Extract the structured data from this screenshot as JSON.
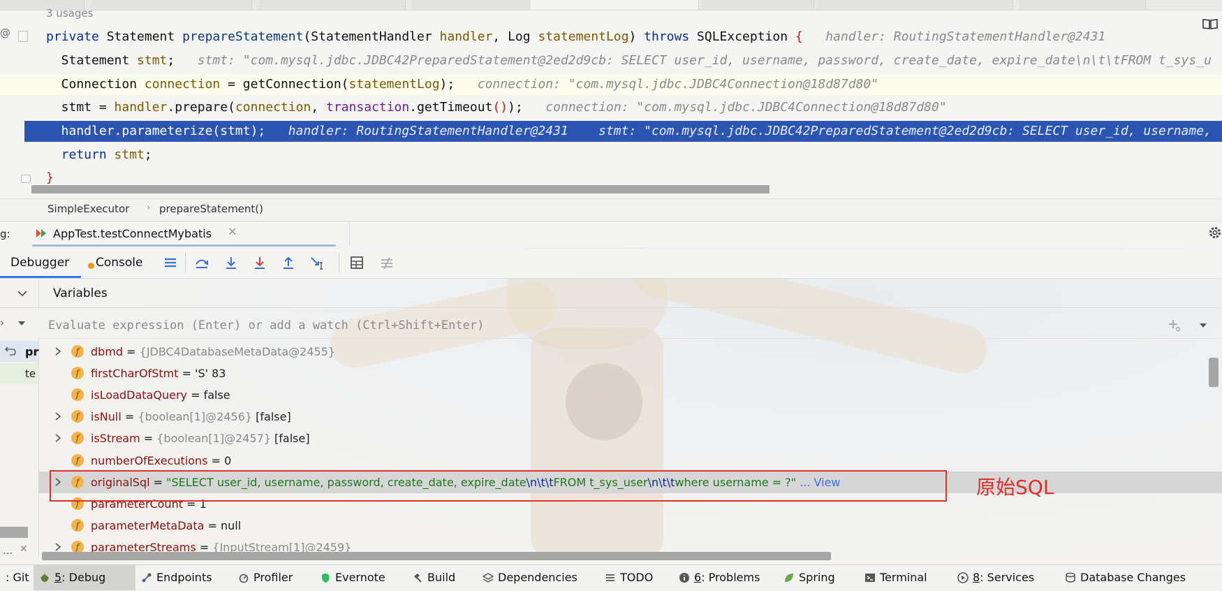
{
  "editor": {
    "usages": "3 usages",
    "gutter_marker": "@",
    "lines": [
      {
        "segments": [
          [
            "kw",
            "private "
          ],
          [
            "ty",
            "Statement "
          ],
          [
            "fn",
            "prepareStatement"
          ],
          [
            "ty",
            "(StatementHandler "
          ],
          [
            "pv",
            "handler"
          ],
          [
            "ty",
            ", Log "
          ],
          [
            "pv",
            "statementLog"
          ],
          [
            "ty",
            ") "
          ],
          [
            "kw",
            "throws "
          ],
          [
            "ty",
            "SQLException "
          ],
          [
            "brace-red",
            "{"
          ],
          [
            "hint",
            "   handler: RoutingStatementHandler@2431"
          ]
        ]
      },
      {
        "segments": [
          [
            "ty",
            "  Statement "
          ],
          [
            "pv",
            "stmt"
          ],
          [
            "ty",
            ";"
          ],
          [
            "hint",
            "   stmt: \"com.mysql.jdbc.JDBC42PreparedStatement@2ed2d9cb: SELECT user_id, username, password, create_date, expire_date\\n\\t\\tFROM t_sys_u"
          ]
        ]
      },
      {
        "segments": [
          [
            "ty",
            "  Connection "
          ],
          [
            "pv",
            "connection"
          ],
          [
            "ty",
            " = getConnection("
          ],
          [
            "pv",
            "statementLog"
          ],
          [
            "ty",
            ");"
          ],
          [
            "hint",
            "   connection: \"com.mysql.jdbc.JDBC4Connection@18d87d80\""
          ]
        ]
      },
      {
        "segments": [
          [
            "ty",
            "  stmt = "
          ],
          [
            "pv",
            "handler"
          ],
          [
            "ty",
            ".prepare("
          ],
          [
            "pv",
            "connection"
          ],
          [
            "ty",
            ", "
          ],
          [
            "pr",
            "transaction"
          ],
          [
            "ty",
            ".getTimeout"
          ],
          [
            "brace-red",
            "()"
          ],
          [
            "ty",
            ");"
          ],
          [
            "hint",
            "   connection: \"com.mysql.jdbc.JDBC4Connection@18d87d80\""
          ]
        ]
      },
      {
        "segments": [
          [
            "plain",
            "  handler.parameterize(stmt);"
          ],
          [
            "hint",
            "   handler: RoutingStatementHandler@2431    stmt: \"com.mysql.jdbc.JDBC42PreparedStatement@2ed2d9cb: SELECT user_id, username,"
          ]
        ]
      },
      {
        "segments": [
          [
            "kw",
            "  return "
          ],
          [
            "pv",
            "stmt"
          ],
          [
            "ty",
            ";"
          ]
        ]
      },
      {
        "segments": [
          [
            "brace-red",
            "}"
          ]
        ]
      }
    ]
  },
  "breadcrumb": {
    "class_name": "SimpleExecutor",
    "separator": "›",
    "method_name": "prepareStatement()"
  },
  "debug_window": {
    "title_prefix": "g:",
    "run_config": "AppTest.testConnectMybatis",
    "close_glyph": "✕",
    "tabs": {
      "debugger": "Debugger",
      "console": "Console"
    },
    "variables_title": "Variables",
    "eval_placeholder": "Evaluate expression (Enter) or add a watch (Ctrl+Shift+Enter)",
    "eval_left_glyph": "›",
    "frames": [
      {
        "label": "pr"
      },
      {
        "label": "te"
      }
    ],
    "frames_footer": "..."
  },
  "variables": [
    {
      "name": "dbmd",
      "eq": " = ",
      "type": "{JDBC4DatabaseMetaData@2455}",
      "value": "",
      "expandable": true
    },
    {
      "name": "firstCharOfStmt",
      "eq": " = ",
      "type": "",
      "value": "'S' 83",
      "expandable": false
    },
    {
      "name": "isLoadDataQuery",
      "eq": " = ",
      "type": "",
      "value": "false",
      "expandable": false
    },
    {
      "name": "isNull",
      "eq": " = ",
      "type": "{boolean[1]@2456}",
      "value": " [false]",
      "expandable": true
    },
    {
      "name": "isStream",
      "eq": " = ",
      "type": "{boolean[1]@2457}",
      "value": " [false]",
      "expandable": true
    },
    {
      "name": "numberOfExecutions",
      "eq": " = ",
      "type": "",
      "value": "0",
      "expandable": false
    },
    {
      "name": "originalSql",
      "eq": " = ",
      "type": "",
      "value": "",
      "expandable": true,
      "selected": true,
      "sql_parts": [
        [
          "vs",
          "\"SELECT user_id, username, password, create_date, expire_date"
        ],
        [
          "vesc",
          "\\n\\t\\t"
        ],
        [
          "vs",
          "FROM t_sys_user"
        ],
        [
          "vesc",
          "\\n\\t\\t"
        ],
        [
          "vs",
          "where username = ?\""
        ]
      ],
      "view_link": " ... View"
    },
    {
      "name": "parameterCount",
      "eq": " = ",
      "type": "",
      "value": "1",
      "expandable": false
    },
    {
      "name": "parameterMetaData",
      "eq": " = ",
      "type": "",
      "value": "null",
      "expandable": false
    },
    {
      "name": "parameterStreams",
      "eq": " = ",
      "type": "{InputStream[1]@2459}",
      "value": "",
      "expandable": true
    }
  ],
  "annotation": {
    "text": "原始SQL",
    "color": "#e0302a"
  },
  "bottom_bar": [
    {
      "id": "git",
      "num": "",
      "label": ": Git",
      "icon": "none"
    },
    {
      "id": "debug",
      "num": "5",
      "label": ": Debug",
      "icon": "bug-icon"
    },
    {
      "id": "endpoints",
      "num": "",
      "label": "Endpoints",
      "icon": "endpoints-icon"
    },
    {
      "id": "profiler",
      "num": "",
      "label": "Profiler",
      "icon": "profiler-icon"
    },
    {
      "id": "evernote",
      "num": "",
      "label": "Evernote",
      "icon": "evernote-icon"
    },
    {
      "id": "build",
      "num": "",
      "label": "Build",
      "icon": "hammer-icon"
    },
    {
      "id": "dependencies",
      "num": "",
      "label": "Dependencies",
      "icon": "layers-icon"
    },
    {
      "id": "todo",
      "num": "",
      "label": "TODO",
      "icon": "list-icon"
    },
    {
      "id": "problems",
      "num": "6",
      "label": ": Problems",
      "icon": "info-icon"
    },
    {
      "id": "spring",
      "num": "",
      "label": "Spring",
      "icon": "spring-icon"
    },
    {
      "id": "terminal",
      "num": "",
      "label": "Terminal",
      "icon": "terminal-icon"
    },
    {
      "id": "services",
      "num": "8",
      "label": ": Services",
      "icon": "play-icon"
    },
    {
      "id": "dbchanges",
      "num": "",
      "label": "Database Changes",
      "icon": "database-icon"
    }
  ],
  "colors": {
    "accent": "#3573f0",
    "selection": "#2c55b1",
    "annotation": "#e0302a"
  }
}
